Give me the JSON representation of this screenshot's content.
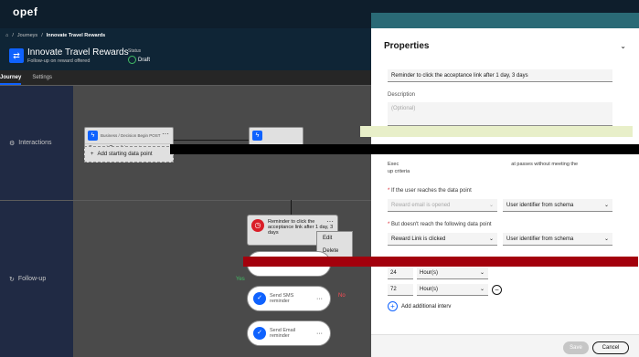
{
  "topbar": {
    "logo": "opef"
  },
  "breadcrumb": {
    "items": [
      "Journeys",
      "Innovate Travel Rewards"
    ]
  },
  "header": {
    "title": "Innovate Travel Rewards",
    "subtitle": "Follow-up on reward offered",
    "status_label": "Status",
    "status_value": "Draft"
  },
  "tabs": [
    {
      "label": "Journey"
    },
    {
      "label": "Settings"
    }
  ],
  "canvas": {
    "lanes": [
      {
        "label": "Interactions"
      },
      {
        "label": "Follow-up"
      }
    ],
    "node1": {
      "type": "Business / Decision Begin POST",
      "body": "Reward Email is sent"
    },
    "add_start": "Add starting data point",
    "reminder": {
      "text": "Reminder to click the acceptance link after 1 day, 3 days"
    },
    "menu": [
      "Edit",
      "Delete"
    ],
    "pills": [
      {
        "label": "Send SMS reminder"
      },
      {
        "label": "Send Email reminder"
      }
    ],
    "yes": "Yes",
    "no": "No"
  },
  "panel": {
    "title": "Properties",
    "name_value": "Reminder to click the acceptance link after 1 day, 3 days",
    "desc_label": "Description",
    "desc_placeholder": "(Optional)",
    "exec_text_1": "Exec",
    "exec_text_2": "at passes without meeting the",
    "exec_text_3": "up criteria",
    "reach_label": "If the user reaches the data point",
    "reach_select": "Reward email is opened",
    "reach_identifier": "User identifier from schema",
    "notreach_label": "But doesn't reach the following data point",
    "notreach_select": "Reward Link is clicked",
    "notreach_identifier": "User identifier from schema",
    "intervals": [
      {
        "value": "24",
        "unit": "Hour(s)"
      },
      {
        "value": "72",
        "unit": "Hour(s)"
      }
    ],
    "add_interval": "Add additional interv",
    "save": "Save",
    "cancel": "Cancel"
  }
}
